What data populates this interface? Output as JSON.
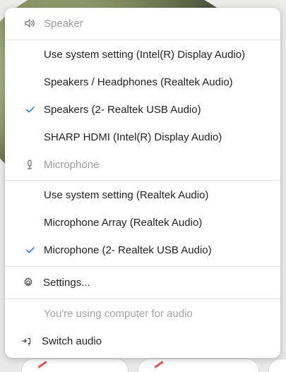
{
  "menu": {
    "speaker_header": "Speaker",
    "speaker_options": [
      {
        "label": "Use system setting (Intel(R) Display Audio)",
        "selected": false
      },
      {
        "label": "Speakers / Headphones (Realtek Audio)",
        "selected": false
      },
      {
        "label": "Speakers (2- Realtek USB Audio)",
        "selected": true
      },
      {
        "label": "SHARP HDMI (Intel(R) Display Audio)",
        "selected": false
      }
    ],
    "microphone_header": "Microphone",
    "microphone_options": [
      {
        "label": "Use system setting (Realtek Audio)",
        "selected": false
      },
      {
        "label": "Microphone Array (Realtek Audio)",
        "selected": false
      },
      {
        "label": "Microphone (2- Realtek USB Audio)",
        "selected": true
      }
    ],
    "settings_label": "Settings...",
    "audio_note": "You're using computer for audio",
    "switch_audio_label": "Switch audio"
  },
  "colors": {
    "accent": "#2f7fd9",
    "muted_text": "#9b9b9b"
  },
  "icons": {
    "speaker": "speaker-icon",
    "microphone": "microphone-icon",
    "settings": "gear-icon",
    "switch_audio": "switch-audio-icon",
    "selected": "checkmark-icon"
  }
}
